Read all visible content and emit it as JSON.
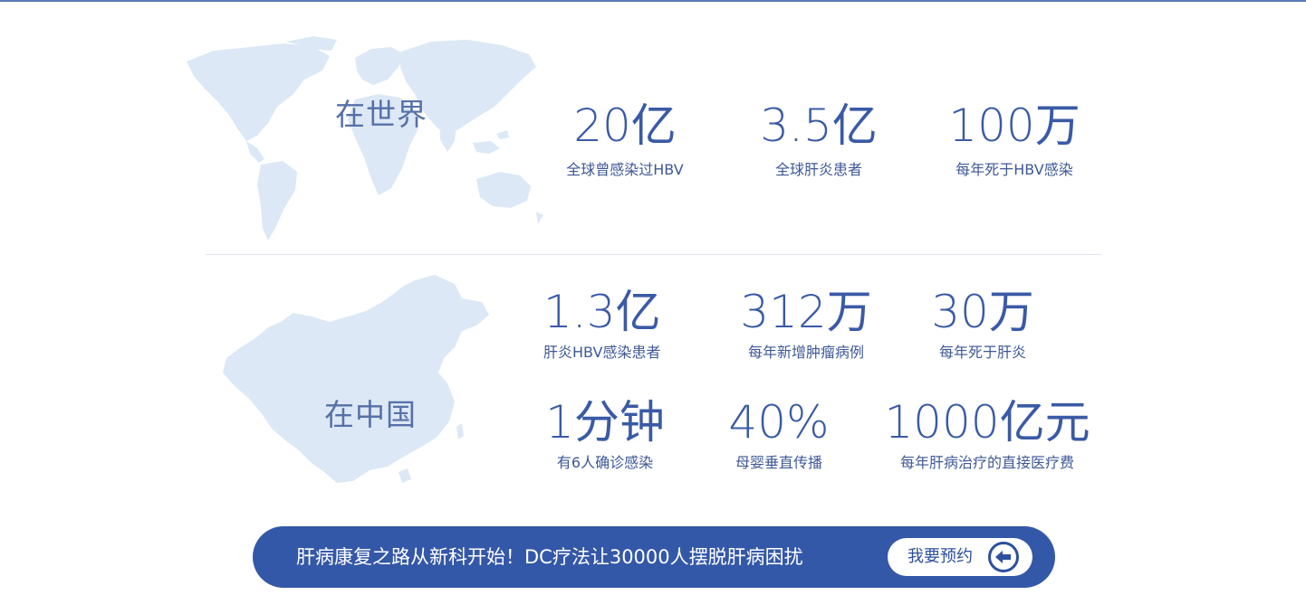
{
  "world": {
    "label": "在世界",
    "stats": [
      {
        "value": "20亿",
        "caption": "全球曾感染过HBV"
      },
      {
        "value": "3.5亿",
        "caption": "全球肝炎患者"
      },
      {
        "value": "100万",
        "caption": "每年死于HBV感染"
      }
    ]
  },
  "china": {
    "label": "在中国",
    "stats": [
      {
        "value": "1.3亿",
        "caption": "肝炎HBV感染患者"
      },
      {
        "value": "312万",
        "caption": "每年新增肿瘤病例"
      },
      {
        "value": "30万",
        "caption": "每年死于肝炎"
      },
      {
        "value": "1分钟",
        "caption": "有6人确诊感染"
      },
      {
        "value": "40%",
        "caption": "母婴垂直传播"
      },
      {
        "value": "1000亿元",
        "caption": "每年肝病治疗的直接医疗费"
      }
    ]
  },
  "cta": {
    "text": "肝病康复之路从新科开始！DC疗法让30000人摆脱肝病困扰",
    "button_label": "我要预约",
    "button_icon": "arrow-left-circle-icon"
  },
  "colors": {
    "accent": "#3458a8",
    "map_fill": "#dce8f5",
    "stat_text": "#3a5aa5"
  }
}
